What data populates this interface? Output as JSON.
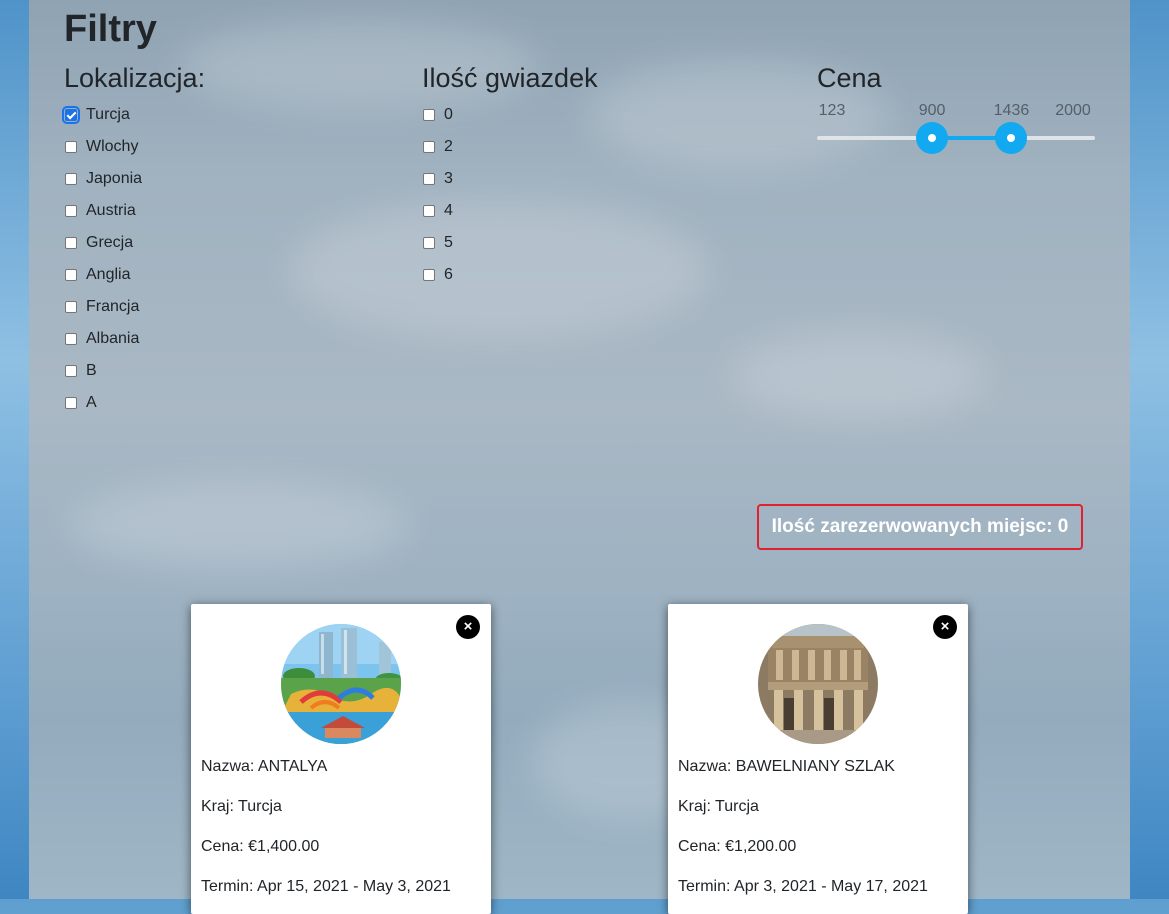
{
  "filters": {
    "title": "Filtry",
    "location": {
      "heading": "Lokalizacja:",
      "options": [
        {
          "label": "Turcja",
          "checked": true
        },
        {
          "label": "Wlochy",
          "checked": false
        },
        {
          "label": "Japonia",
          "checked": false
        },
        {
          "label": "Austria",
          "checked": false
        },
        {
          "label": "Grecja",
          "checked": false
        },
        {
          "label": "Anglia",
          "checked": false
        },
        {
          "label": "Francja",
          "checked": false
        },
        {
          "label": "Albania",
          "checked": false
        },
        {
          "label": "B",
          "checked": false
        },
        {
          "label": "A",
          "checked": false
        }
      ]
    },
    "stars": {
      "heading": "Ilość gwiazdek",
      "options": [
        {
          "label": "0",
          "checked": false
        },
        {
          "label": "2",
          "checked": false
        },
        {
          "label": "3",
          "checked": false
        },
        {
          "label": "4",
          "checked": false
        },
        {
          "label": "5",
          "checked": false
        },
        {
          "label": "6",
          "checked": false
        }
      ]
    },
    "price": {
      "heading": "Cena",
      "min": 123,
      "max": 2000,
      "low": 900,
      "high": 1436,
      "min_label": "123",
      "low_label": "900",
      "high_label": "1436",
      "max_label": "2000",
      "accent_color": "#12a9f0"
    }
  },
  "reserved": {
    "text": "Ilość zarezerwowanych miejsc: 0",
    "border_color": "#e0212f"
  },
  "trips": [
    {
      "name": "Nazwa: ANTALYA",
      "country": "Kraj: Turcja",
      "price": "Cena: €1,400.00",
      "term": "Termin: Apr 15, 2021 - May 3, 2021",
      "image": "resort-pool-photo"
    },
    {
      "name": "Nazwa: BAWELNIANY SZLAK",
      "country": "Kraj: Turcja",
      "price": "Cena: €1,200.00",
      "term": "Termin: Apr 3, 2021 - May 17, 2021",
      "image": "ancient-library-photo"
    }
  ],
  "icons": {
    "close": "×"
  }
}
